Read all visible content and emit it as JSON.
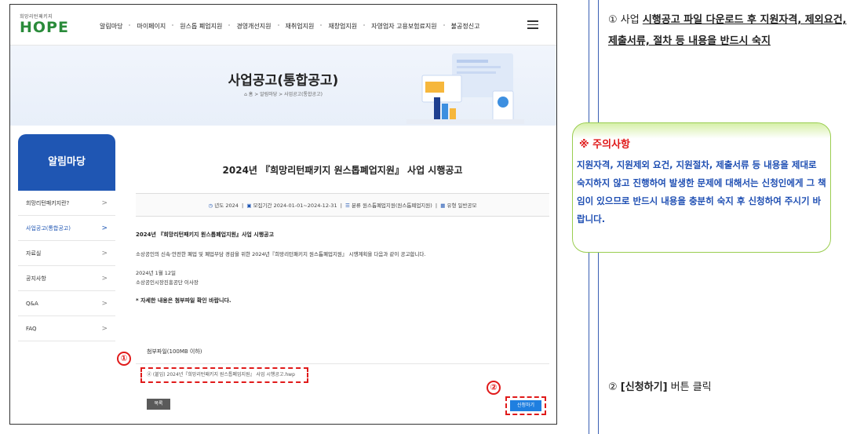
{
  "header": {
    "logo_small": "희망리턴패키지",
    "logo_big": "HOPE",
    "nav": [
      "알림마당",
      "마이페이지",
      "원스톱 폐업지원",
      "경영개선지원",
      "재취업지원",
      "재창업지원",
      "자영업자 고용보험료지원",
      "불공정신고"
    ]
  },
  "banner": {
    "title": "사업공고(통합공고)",
    "breadcrumb": "⌂ 홈  >  알림마당  >  사업공고(통합공고)"
  },
  "sidebar": {
    "title": "알림마당",
    "items": [
      {
        "label": "희망리턴패키지란?",
        "active": false
      },
      {
        "label": "사업공고(통합공고)",
        "active": true
      },
      {
        "label": "자료실",
        "active": false
      },
      {
        "label": "공지사항",
        "active": false
      },
      {
        "label": "Q&A",
        "active": false
      },
      {
        "label": "FAQ",
        "active": false
      }
    ]
  },
  "post": {
    "title": "2024년 『희망리턴패키지 원스톱폐업지원』 사업 시행공고",
    "meta_year_label": "년도",
    "meta_year": "2024",
    "meta_period_label": "모집기간",
    "meta_period": "2024-01-01~2024-12-31",
    "meta_category_label": "분류",
    "meta_category": "원스톱폐업지원(원스톱폐업지원)",
    "meta_type_label": "유형",
    "meta_type": "일반공모",
    "body_heading": "2024년 『희망리턴패키지 원스톱폐업지원』사업 시행공고",
    "body_text": "소상공인의 신속·안전한 폐업 및 폐업부담 경감을 위한 2024년『희망리턴패키지 원스톱폐업지원』 시행계획을 다음과 같이 공고합니다.",
    "body_date": "2024년 1월 12일",
    "body_signer": "소상공인시장진흥공단 이사장",
    "body_note": "* 자세한 내용은 첨부파일 확인 바랍니다.",
    "attach_label": "첨부파일(100MB 이하)",
    "attach_file": "ⓓ (붙임) 2024년『희망리턴패키지 원스톱폐업지원』 사업 시행공고.hwp",
    "list_button": "목록",
    "apply_button": "신청하기"
  },
  "markers": {
    "one": "①",
    "two": "②"
  },
  "instructions": {
    "step1_prefix": "① 사업 ",
    "step1_underlined": "시행공고 파일 다운로드 후 지원자격, 제외요건, 제출서류, 절차 등 내용을 반드시 숙지",
    "notice_title": "※ 주의사항",
    "notice_body": "지원자격, 지원제외 요건, 지원절차, 제출서류 등 내용을 제대로 숙지하지 않고 진행하여 발생한 문제에 대해서는 신청인에게 그 책임이 있으므로 반드시 내용을 충분히 숙지 후 신청하여 주시기 바랍니다.",
    "step2_prefix": "② ",
    "step2_bold": "[신청하기]",
    "step2_suffix": " 버튼 클릭"
  }
}
